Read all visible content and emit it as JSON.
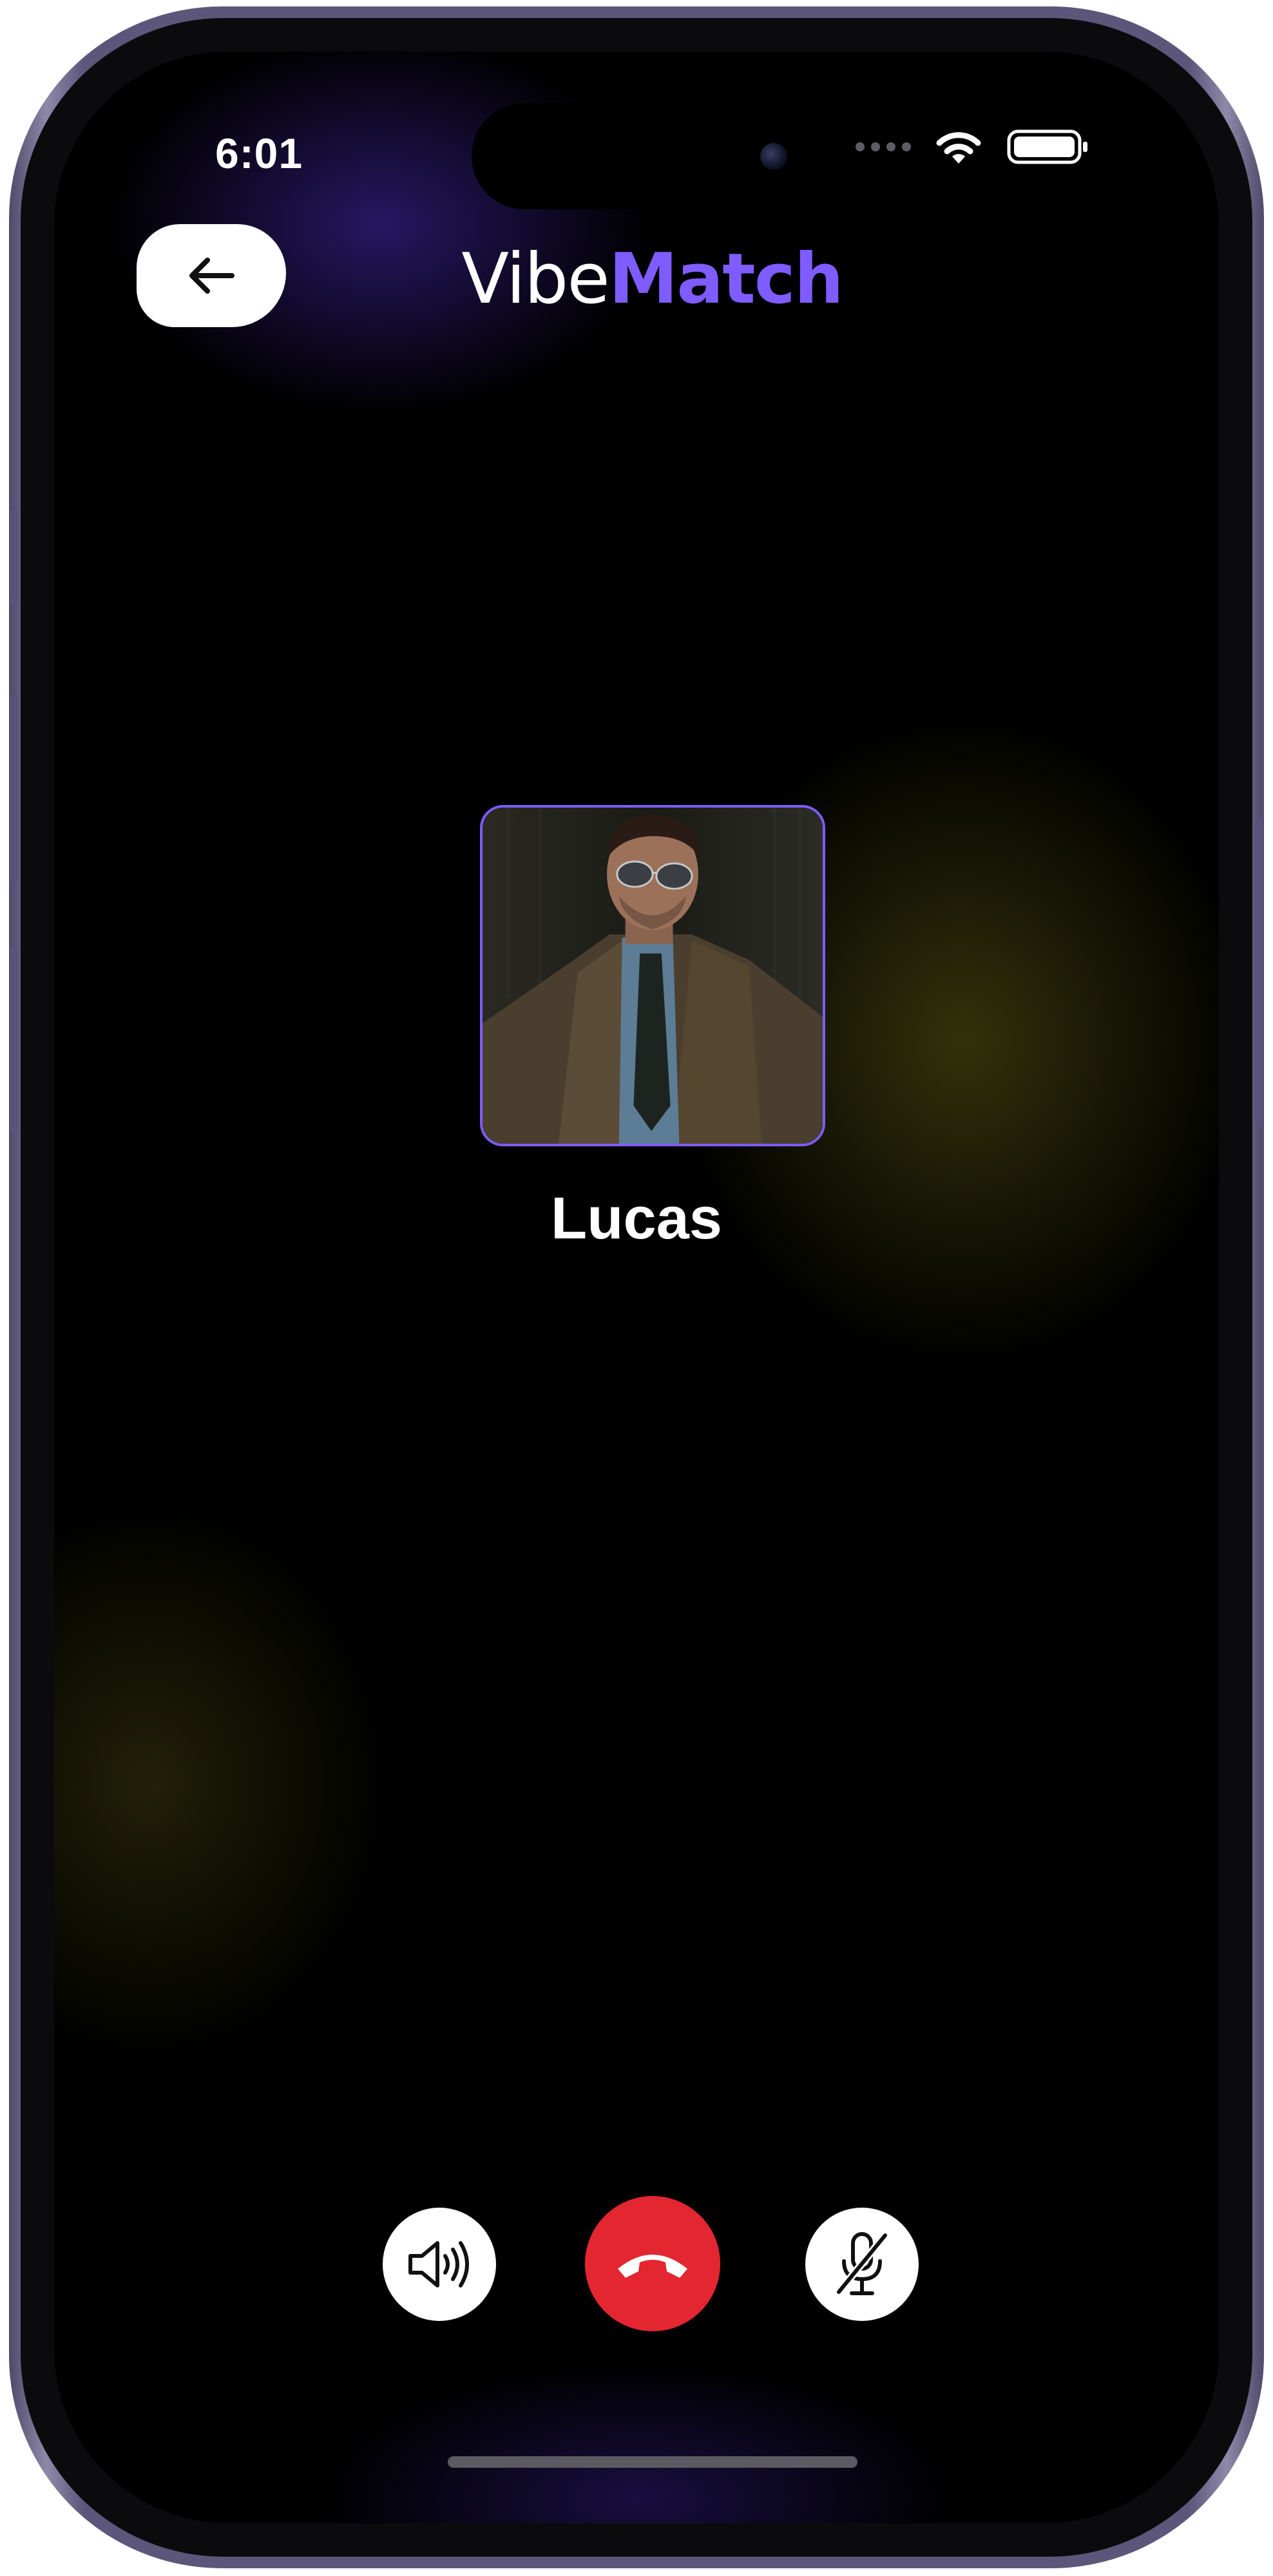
{
  "status_bar": {
    "time": "6:01",
    "icons": [
      "cellular-signal-icon",
      "wifi-icon",
      "battery-icon"
    ]
  },
  "header": {
    "title_part1": "Vibe",
    "title_part2": "Match",
    "back_icon": "arrow-left-icon"
  },
  "caller": {
    "name": "Lucas",
    "avatar_icon": "caller-photo"
  },
  "controls": {
    "speaker_icon": "speaker-icon",
    "end_call_icon": "phone-hangup-icon",
    "mute_icon": "microphone-muted-icon"
  },
  "colors": {
    "accent": "#7F5CFF",
    "end_call": "#E42630",
    "background": "#000000",
    "text": "#FFFFFF"
  }
}
